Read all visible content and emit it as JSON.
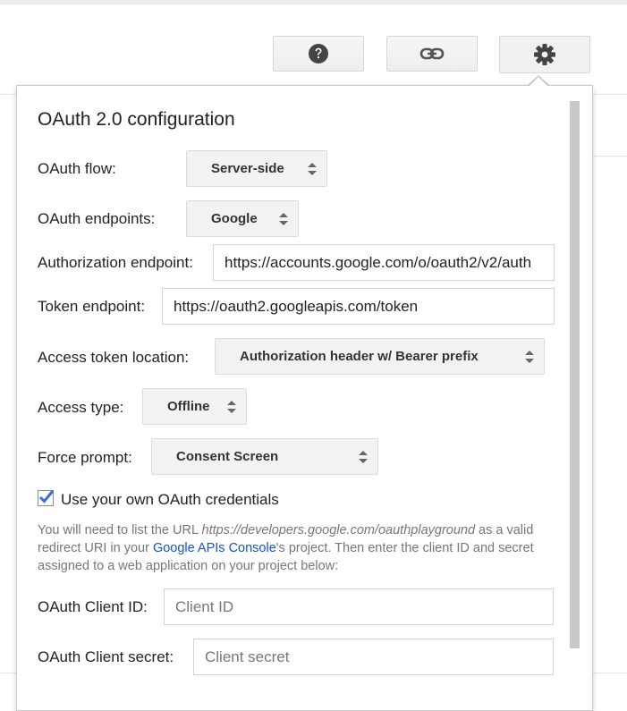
{
  "toolbar": {
    "help_icon": "question-circle",
    "link_icon": "link",
    "settings_icon": "gear"
  },
  "panel": {
    "title": "OAuth 2.0 configuration",
    "flow": {
      "label": "OAuth flow:",
      "value": "Server-side"
    },
    "endpoints": {
      "label": "OAuth endpoints:",
      "value": "Google"
    },
    "authorization_endpoint": {
      "label": "Authorization endpoint:",
      "value": "https://accounts.google.com/o/oauth2/v2/auth"
    },
    "token_endpoint": {
      "label": "Token endpoint:",
      "value": "https://oauth2.googleapis.com/token"
    },
    "access_token_location": {
      "label": "Access token location:",
      "value": "Authorization header w/ Bearer prefix"
    },
    "access_type": {
      "label": "Access type:",
      "value": "Offline"
    },
    "force_prompt": {
      "label": "Force prompt:",
      "value": "Consent Screen"
    },
    "own_credentials": {
      "label": "Use your own OAuth credentials",
      "checked": true
    },
    "note": {
      "part1": "You will need to list the URL ",
      "url": "https://developers.google.com/oauthplayground",
      "part2": " as a valid redirect URI in your ",
      "link": "Google APIs Console",
      "part3": "'s project. Then enter the client ID and secret assigned to a web application on your project below:"
    },
    "client_id": {
      "label": "OAuth Client ID:",
      "placeholder": "Client ID"
    },
    "client_secret": {
      "label": "OAuth Client secret:",
      "placeholder": "Client secret"
    }
  },
  "colors": {
    "link": "#1155cc",
    "checkmark": "#3a6fd8",
    "select_bg": "#f2f2f2"
  }
}
